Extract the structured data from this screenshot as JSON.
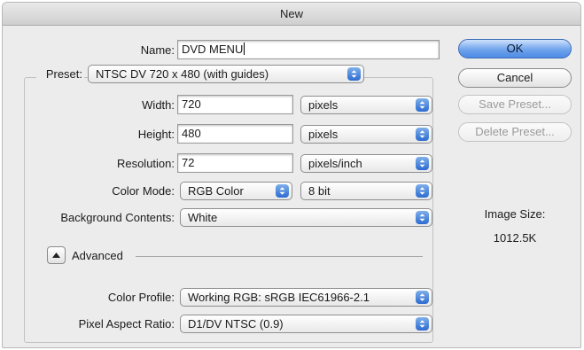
{
  "window": {
    "title": "New"
  },
  "name": {
    "label": "Name:",
    "value": "DVD MENU"
  },
  "preset": {
    "label": "Preset:",
    "value": "NTSC DV 720 x 480 (with guides)"
  },
  "width": {
    "label": "Width:",
    "value": "720",
    "unit": "pixels"
  },
  "height": {
    "label": "Height:",
    "value": "480",
    "unit": "pixels"
  },
  "resolution": {
    "label": "Resolution:",
    "value": "72",
    "unit": "pixels/inch"
  },
  "color_mode": {
    "label": "Color Mode:",
    "mode": "RGB Color",
    "depth": "8 bit"
  },
  "background": {
    "label": "Background Contents:",
    "value": "White"
  },
  "advanced": {
    "label": "Advanced"
  },
  "color_profile": {
    "label": "Color Profile:",
    "value": "Working RGB:  sRGB IEC61966-2.1"
  },
  "pixel_aspect": {
    "label": "Pixel Aspect Ratio:",
    "value": "D1/DV NTSC (0.9)"
  },
  "buttons": {
    "ok": "OK",
    "cancel": "Cancel",
    "save_preset": "Save Preset...",
    "delete_preset": "Delete Preset..."
  },
  "image_size": {
    "label": "Image Size:",
    "value": "1012.5K"
  },
  "colors": {
    "accent": "#4d8be5",
    "window_bg": "#ececec"
  }
}
